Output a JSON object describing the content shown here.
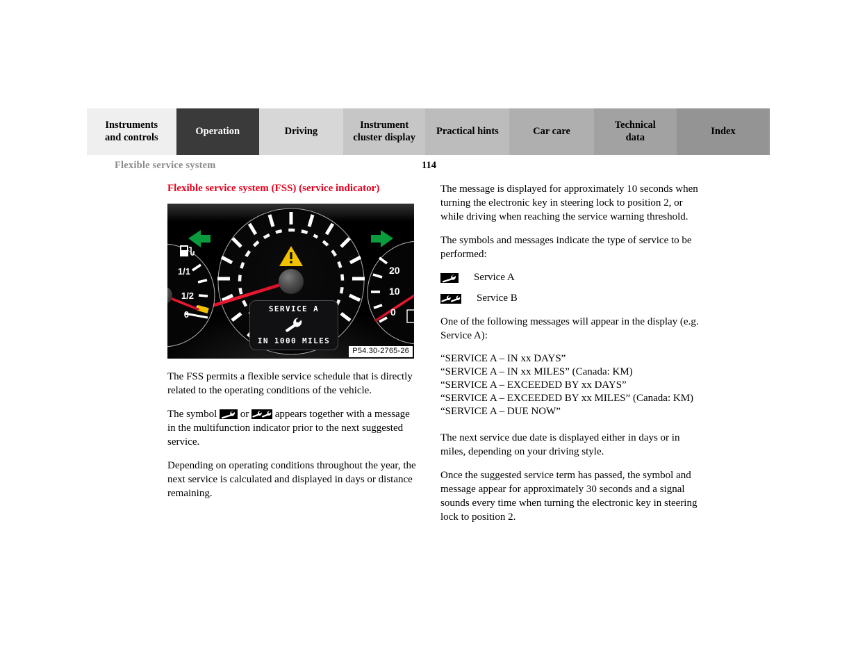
{
  "tabs": [
    {
      "label": "Instruments\nand controls",
      "bg": "#efefef",
      "active": false
    },
    {
      "label": "Operation",
      "bg": "#3a3a3a",
      "active": true
    },
    {
      "label": "Driving",
      "bg": "#d7d7d7",
      "active": false
    },
    {
      "label": "Instrument\ncluster display",
      "bg": "#c6c6c6",
      "active": false
    },
    {
      "label": "Practical hints",
      "bg": "#bcbcbc",
      "active": false
    },
    {
      "label": "Car care",
      "bg": "#afafaf",
      "active": false
    },
    {
      "label": "Technical\ndata",
      "bg": "#a2a2a2",
      "active": false
    },
    {
      "label": "Index",
      "bg": "#949494",
      "active": false
    }
  ],
  "header": {
    "running_head": "Flexible service system",
    "page_number": "114"
  },
  "colors": {
    "section_title": "#e8001c",
    "running_head": "#8a8a8a",
    "warning_triangle": "#f2c200",
    "turn_signal": "#0a9c3c",
    "needle": "#e8102a",
    "fuel_reserve": "#f2c200"
  },
  "left_column": {
    "section_title": "Flexible service system (FSS)\n(service indicator)",
    "figure": {
      "caption_tag": "P54.30-2765-26",
      "lcd": {
        "line1": "SERVICE A",
        "icon": "wrench-icon",
        "line2": "IN 1000 MILES"
      },
      "fuel_gauge_labels": [
        "1/1",
        "1/2",
        "0"
      ],
      "fuel_icon": "fuel-pump-icon",
      "right_gauge_labels": [
        "20",
        "10",
        "0"
      ],
      "indicators": {
        "left_turn": "left-turn-arrow-icon",
        "right_turn": "right-turn-arrow-icon",
        "warning": "warning-triangle-icon"
      }
    },
    "paragraphs": [
      "The FSS permits a flexible service schedule that is directly related to the operating conditions of the vehicle.",
      "Depending on operating conditions throughout the year, the next service is calculated and displayed in days or distance remaining."
    ],
    "symbol_sentence": {
      "before": "The symbol ",
      "middle": " or ",
      "after": " appears together with a message in the multifunction indicator prior to the next suggested service."
    }
  },
  "right_column": {
    "paragraphs": [
      "The message is displayed for approximately 10 seconds when turning the electronic key in steering lock to position 2, or while driving when reaching the service warning threshold.",
      "The symbols and messages indicate the type of service to be performed:"
    ],
    "service_types": [
      {
        "symbol": "service-a-wrench-icon",
        "label": "Service A"
      },
      {
        "symbol": "service-b-wrench-icon",
        "label": "Service B"
      }
    ],
    "intro_messages": "One of the following messages will appear in the display (e.g. Service A):",
    "messages": [
      "“SERVICE A – IN xx DAYS”",
      "“SERVICE A – IN xx MILES” (Canada: KM)",
      "“SERVICE A – EXCEEDED BY xx DAYS”",
      "“SERVICE A – EXCEEDED BY xx MILES” (Canada: KM)",
      "“SERVICE A – DUE NOW”"
    ],
    "closing_paragraphs": [
      "The next service due date is displayed either in days or in miles, depending on your driving style.",
      "Once the suggested service term has passed, the symbol and message appear for approximately 30 seconds and a signal sounds every time when turning the electronic key in steering lock to position 2."
    ]
  }
}
